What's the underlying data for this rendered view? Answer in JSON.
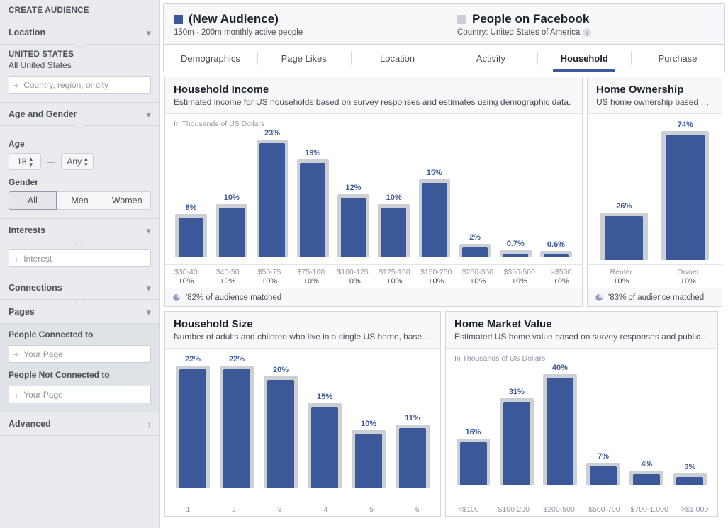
{
  "sidebar": {
    "title": "CREATE AUDIENCE",
    "sections": {
      "location": {
        "label": "Location",
        "chevron": "chevron-down"
      },
      "age_gender": {
        "label": "Age and Gender",
        "chevron": "chevron-down"
      },
      "interests": {
        "label": "Interests",
        "chevron": "chevron-down"
      },
      "connections": {
        "label": "Connections",
        "chevron": "chevron-down"
      },
      "pages": {
        "label": "Pages",
        "chevron": "chevron-down"
      },
      "advanced": {
        "label": "Advanced",
        "chevron": "chevron-right"
      }
    },
    "location": {
      "country_heading": "UNITED STATES",
      "country_sub": "All United States",
      "input_placeholder": "Country, region, or city",
      "plus": "+"
    },
    "age_gender": {
      "age_label": "Age",
      "age_min": "18",
      "age_max": "Any",
      "dash": "—",
      "gender_label": "Gender",
      "gender_options": [
        "All",
        "Men",
        "Women"
      ],
      "gender_selected": "All"
    },
    "interests": {
      "input_placeholder": "Interest",
      "plus": "+"
    },
    "pages": {
      "connected_label": "People Connected to",
      "connected_placeholder": "Your Page",
      "not_connected_label": "People Not Connected to",
      "not_connected_placeholder": "Your Page",
      "plus": "+"
    }
  },
  "header": {
    "audience": {
      "name": "(New Audience)",
      "subtitle": "150m - 200m monthly active people",
      "swatch_color": "#3b5998"
    },
    "comparison": {
      "name": "People on Facebook",
      "subtitle": "Country: United States of America",
      "swatch_color": "#ccd0d5",
      "info_icon": "i"
    },
    "tabs": [
      {
        "label": "Demographics",
        "active": false
      },
      {
        "label": "Page Likes",
        "active": false
      },
      {
        "label": "Location",
        "active": false
      },
      {
        "label": "Activity",
        "active": false
      },
      {
        "label": "Household",
        "active": true
      },
      {
        "label": "Purchase",
        "active": false
      }
    ]
  },
  "chart_data": [
    {
      "id": "household-income",
      "type": "bar",
      "title": "Household Income",
      "subtitle": "Estimated income for US households based on survey responses and estimates using demographic data.",
      "units_note": "In Thousands of US Dollars",
      "categories": [
        "$30-40",
        "$40-50",
        "$50-75",
        "$75-100",
        "$100-125",
        "$125-150",
        "$150-250",
        "$250-350",
        "$350-500",
        ">$500"
      ],
      "value_labels": [
        "8%",
        "10%",
        "23%",
        "19%",
        "12%",
        "10%",
        "15%",
        "2%",
        "0.7%",
        "0.6%"
      ],
      "values": [
        8,
        10,
        23,
        19,
        12,
        10,
        15,
        2,
        0.7,
        0.6
      ],
      "comparison_values": [
        8,
        10,
        23,
        19,
        12,
        10,
        15,
        2,
        0.7,
        0.6
      ],
      "deltas": [
        "+0%",
        "+0%",
        "+0%",
        "+0%",
        "+0%",
        "+0%",
        "+0%",
        "+0%",
        "+0%",
        "+0%"
      ],
      "ylim": [
        0,
        23
      ],
      "footer": "'82% of audience matched",
      "series": [
        {
          "name": "(New Audience)",
          "color": "#3b5998",
          "values": [
            8,
            10,
            23,
            19,
            12,
            10,
            15,
            2,
            0.7,
            0.6
          ]
        },
        {
          "name": "People on Facebook",
          "color": "#ccd0d5",
          "values": [
            8,
            10,
            23,
            19,
            12,
            10,
            15,
            2,
            0.7,
            0.6
          ]
        }
      ]
    },
    {
      "id": "home-ownership",
      "type": "bar",
      "title": "Home Ownership",
      "subtitle": "US home ownership based o…",
      "units_note": "",
      "categories": [
        "Renter",
        "Owner"
      ],
      "value_labels": [
        "26%",
        "74%"
      ],
      "values": [
        26,
        74
      ],
      "comparison_values": [
        26,
        74
      ],
      "deltas": [
        "+0%",
        "+0%"
      ],
      "ylim": [
        0,
        74
      ],
      "footer": "'83% of audience matched",
      "series": [
        {
          "name": "(New Audience)",
          "color": "#3b5998",
          "values": [
            26,
            74
          ]
        },
        {
          "name": "People on Facebook",
          "color": "#ccd0d5",
          "values": [
            26,
            74
          ]
        }
      ]
    },
    {
      "id": "household-size",
      "type": "bar",
      "title": "Household Size",
      "subtitle": "Number of adults and children who live in a single US home, base…",
      "units_note": "",
      "categories": [
        "1",
        "2",
        "3",
        "4",
        "5",
        "6"
      ],
      "value_labels": [
        "22%",
        "22%",
        "20%",
        "15%",
        "10%",
        "11%"
      ],
      "values": [
        22,
        22,
        20,
        15,
        10,
        11
      ],
      "comparison_values": [
        22,
        22,
        20,
        15,
        10,
        11
      ],
      "deltas": [
        "",
        "",
        "",
        "",
        "",
        ""
      ],
      "ylim": [
        0,
        22
      ],
      "footer": "",
      "series": [
        {
          "name": "(New Audience)",
          "color": "#3b5998",
          "values": [
            22,
            22,
            20,
            15,
            10,
            11
          ]
        },
        {
          "name": "People on Facebook",
          "color": "#ccd0d5",
          "values": [
            22,
            22,
            20,
            15,
            10,
            11
          ]
        }
      ]
    },
    {
      "id": "home-market-value",
      "type": "bar",
      "title": "Home Market Value",
      "subtitle": "Estimated US home value based on survey responses and publicly…",
      "units_note": "In Thousands of US Dollars",
      "categories": [
        "<$100",
        "$100-200",
        "$200-500",
        "$500-700",
        "$700-1,000",
        ">$1,000"
      ],
      "value_labels": [
        "16%",
        "31%",
        "40%",
        "7%",
        "4%",
        "3%"
      ],
      "values": [
        16,
        31,
        40,
        7,
        4,
        3
      ],
      "comparison_values": [
        16,
        31,
        40,
        7,
        4,
        3
      ],
      "deltas": [
        "",
        "",
        "",
        "",
        "",
        ""
      ],
      "ylim": [
        0,
        40
      ],
      "footer": "",
      "series": [
        {
          "name": "(New Audience)",
          "color": "#3b5998",
          "values": [
            16,
            31,
            40,
            7,
            4,
            3
          ]
        },
        {
          "name": "People on Facebook",
          "color": "#ccd0d5",
          "values": [
            16,
            31,
            40,
            7,
            4,
            3
          ]
        }
      ]
    }
  ]
}
